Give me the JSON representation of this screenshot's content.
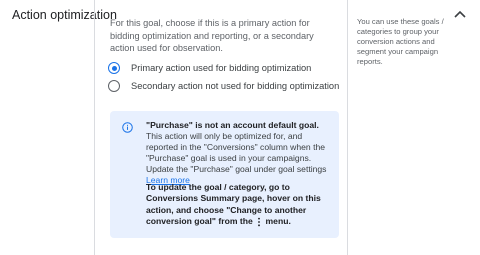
{
  "section": {
    "title": "Action optimization",
    "description": "For this goal, choose if this is a primary action for bidding optimization and reporting, or a secondary action used for observation."
  },
  "radio_options": [
    {
      "label": "Primary action used for bidding optimization",
      "checked": true
    },
    {
      "label": "Secondary action not used for bidding optimization",
      "checked": false
    }
  ],
  "info_box": {
    "icon": "info-icon",
    "bold_lead": "\"Purchase\" is not an account default goal.",
    "text": " This action will only be optimized for, and reported in the \"Conversions\" column when the \"Purchase\" goal is used in your campaigns. Update the \"Purchase\" goal under goal settings ",
    "link_text": "Learn more",
    "instruction_before": "To update the goal / category, go to Conversions Summary page, hover on this action, and choose \"Change to another conversion goal\" from the",
    "instruction_after": "menu.",
    "menu_icon": "more-vert-icon"
  },
  "side_note": "You can use these goals / categories to group your conversion actions and segment your campaign reports.",
  "collapse_icon": "chevron-up-icon",
  "colors": {
    "accent": "#1a73e8",
    "info_bg": "#e8f0fe",
    "divider": "#dadce0"
  }
}
